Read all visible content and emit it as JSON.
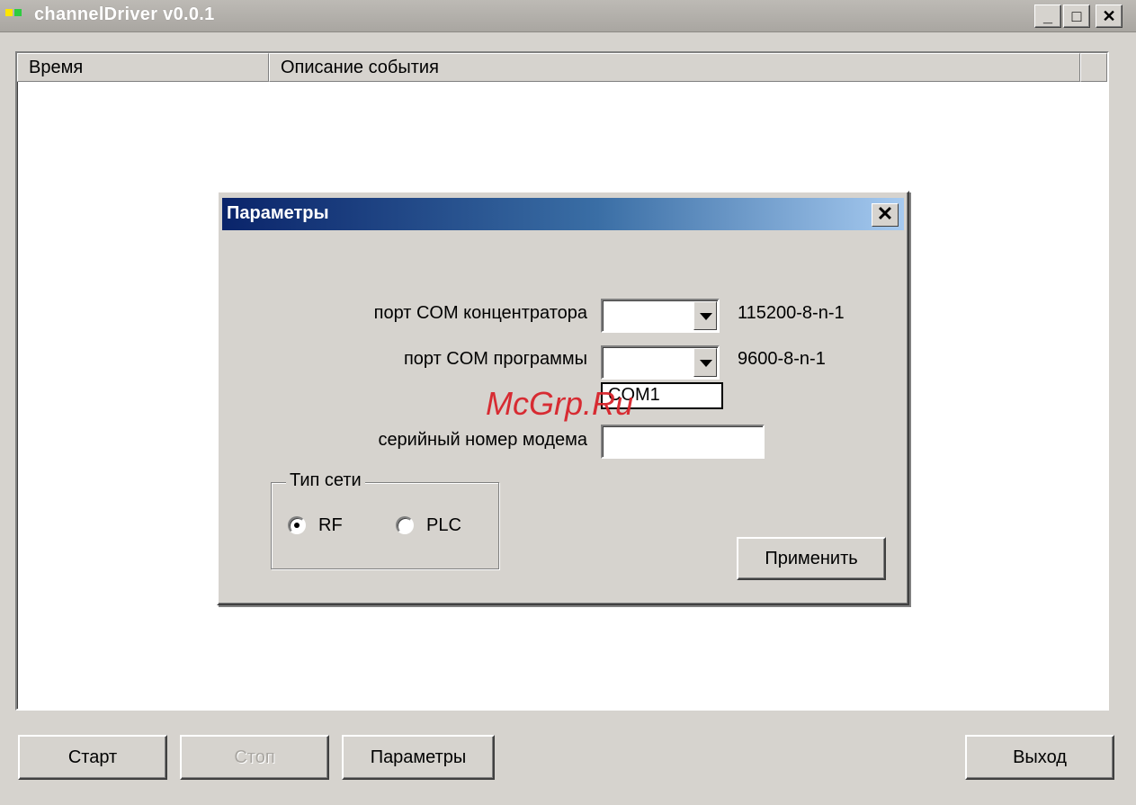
{
  "window": {
    "title": "channelDriver v0.0.1",
    "icon_colors": [
      "#ffe600",
      "#2ecc40"
    ],
    "caption_buttons": {
      "minimize": "_",
      "maximize": "□",
      "close": "✕"
    }
  },
  "event_list": {
    "columns": [
      "Время",
      "Описание события"
    ]
  },
  "dialog": {
    "title": "Параметры",
    "close_glyph": "✕",
    "hub_port_label": "порт COM концентратора",
    "hub_port_value": "",
    "hub_port_info": "115200-8-n-1",
    "app_port_label": "порт COM программы",
    "app_port_value": "",
    "app_port_info": "9600-8-n-1",
    "dropdown_option": "COM1",
    "serial_label": "серийный номер модема",
    "serial_value": "",
    "network_group_label": "Тип сети",
    "radio_rf_label": "RF",
    "radio_plc_label": "PLC",
    "radio_selected": "RF",
    "apply_label": "Применить"
  },
  "footer": {
    "start_label": "Старт",
    "stop_label": "Стоп",
    "params_label": "Параметры",
    "exit_label": "Выход"
  },
  "watermark": "McGrp.Ru"
}
